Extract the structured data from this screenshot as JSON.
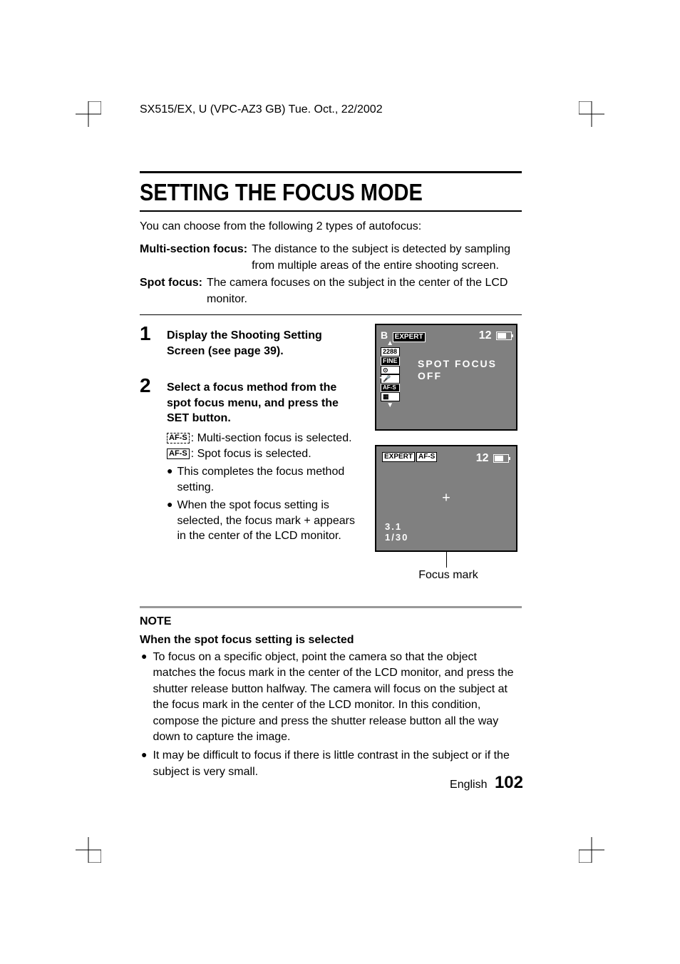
{
  "header": "SX515/EX, U (VPC-AZ3 GB)   Tue. Oct., 22/2002",
  "title": "SETTING THE FOCUS MODE",
  "intro": "You can choose from the following 2 types of autofocus:",
  "definitions": [
    {
      "label": "Multi-section focus:",
      "text": "The distance to the subject is detected by sampling from multiple areas of the entire shooting screen."
    },
    {
      "label": "Spot focus:",
      "text": "The camera focuses on the subject in the center of the LCD monitor."
    }
  ],
  "steps": [
    {
      "num": "1",
      "title": "Display the Shooting Setting Screen (see page 39)."
    },
    {
      "num": "2",
      "title": "Select a focus method from the spot focus menu, and press the SET button.",
      "icons": [
        {
          "icon": "AF-S",
          "dashed": true,
          "text": ": Multi-section focus is selected."
        },
        {
          "icon": "AF-S",
          "dashed": false,
          "text": ": Spot focus is selected."
        }
      ],
      "bullets": [
        "This completes the focus method setting.",
        "When the spot focus setting is selected, the focus mark + appears in the center of the LCD monitor."
      ]
    }
  ],
  "lcd1": {
    "b": "B",
    "expert": "EXPERT",
    "count": "12",
    "size": "2288",
    "fine": "FINE",
    "menu1": "SPOT  FOCUS",
    "menu2": "OFF",
    "afs": "AF-S"
  },
  "lcd2": {
    "expert": "EXPERT",
    "afs": "AF-S",
    "count": "12",
    "aperture": "3.1",
    "shutter": "1/30",
    "focusMarkLabel": "Focus mark"
  },
  "note": {
    "heading": "NOTE",
    "sub": "When the spot focus setting is selected",
    "bullets": [
      "To focus on a specific object, point the camera so that the object matches the focus mark in the center of the LCD monitor, and press the shutter release button halfway. The camera will focus on the subject at the focus mark in the center of the LCD monitor. In this condition, compose the picture and press the shutter release button all the way down to capture the image.",
      "It may be difficult to focus if there is little contrast in the subject or if the subject is very small."
    ]
  },
  "footer": {
    "lang": "English",
    "page": "102"
  }
}
